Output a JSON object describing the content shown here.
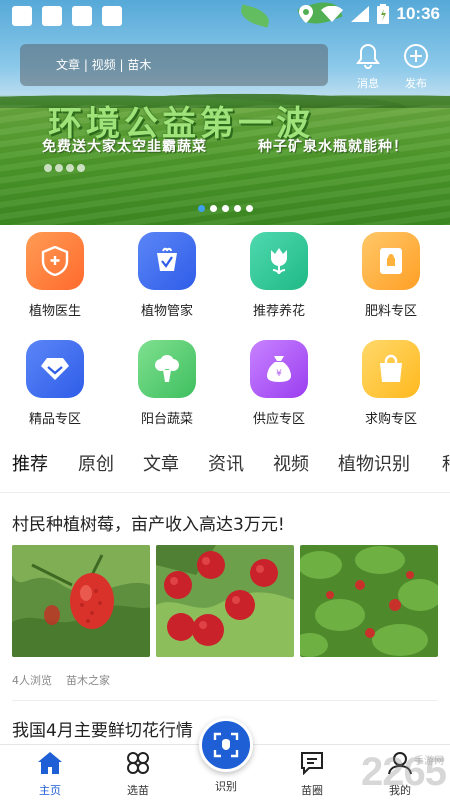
{
  "status_bar": {
    "time": "10:36"
  },
  "search": {
    "placeholder": "文章 | 视频 | 苗木"
  },
  "top_actions": {
    "messages_label": "消息",
    "publish_label": "发布"
  },
  "banner": {
    "headline": "环境公益第一波",
    "slogan_left": "免费送大家太空韭霸蔬菜",
    "slogan_right": "种子矿泉水瓶就能种！",
    "slide_count": 5,
    "active_slide": 1
  },
  "categories": [
    {
      "label": "植物医生",
      "icon": "shield-plus-icon",
      "color": "#ff7a3d"
    },
    {
      "label": "植物管家",
      "icon": "plant-manager-icon",
      "color": "#3c6df0"
    },
    {
      "label": "推荐养花",
      "icon": "tulip-icon",
      "color": "#2fc69a"
    },
    {
      "label": "肥料专区",
      "icon": "fertilizer-bag-icon",
      "color": "#ffb23c"
    },
    {
      "label": "精品专区",
      "icon": "diamond-icon",
      "color": "#3c6df0"
    },
    {
      "label": "阳台蔬菜",
      "icon": "broccoli-icon",
      "color": "#5dd07a"
    },
    {
      "label": "供应专区",
      "icon": "money-bag-icon",
      "color": "#b05cf0"
    },
    {
      "label": "求购专区",
      "icon": "shopping-bag-icon",
      "color": "#ffc53c"
    }
  ],
  "tabs": [
    "推荐",
    "原创",
    "文章",
    "资讯",
    "视频",
    "植物识别",
    "种"
  ],
  "active_tab": 0,
  "feed": [
    {
      "title": "村民种植树莓，亩产收入高达3万元!",
      "views": "4人浏览",
      "source": "苗木之家"
    },
    {
      "title": "我国4月主要鲜切花行情"
    }
  ],
  "bottom_nav": {
    "home": "主页",
    "select": "选苗",
    "identify": "识别",
    "circle": "苗圈",
    "mine": "我的"
  },
  "watermark": {
    "main": "2265",
    "sub": "手游网"
  },
  "colors": {
    "primary": "#1e5fd6",
    "carousel_active": "#3fa0f0"
  }
}
